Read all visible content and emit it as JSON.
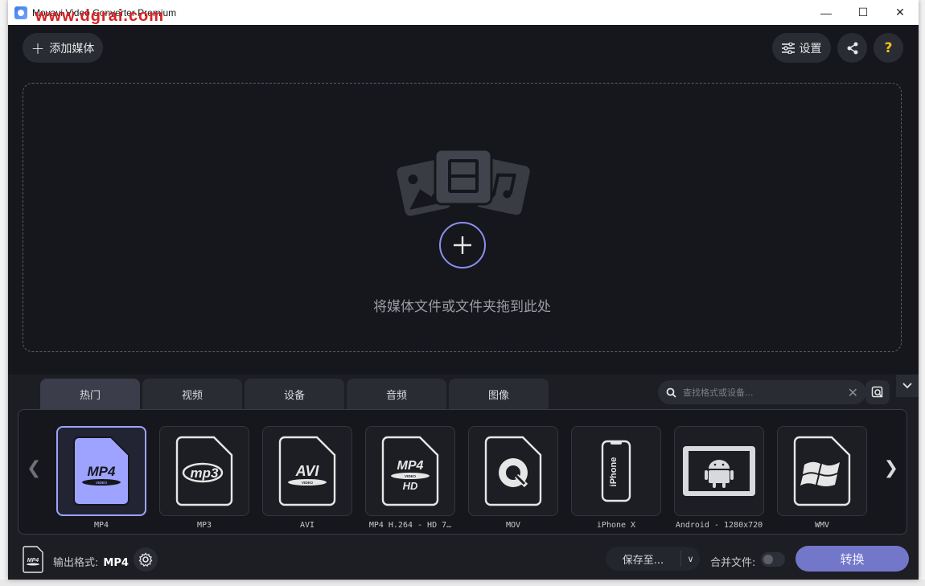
{
  "window": {
    "title": "Movavi Video Converter Premium",
    "watermark": "www.dgrai.com",
    "controls": {
      "minimize": "—",
      "maximize": "☐",
      "close": "✕"
    }
  },
  "toolbar": {
    "add_media_label": "添加媒体",
    "settings_label": "设置",
    "help_label": "?"
  },
  "dropzone": {
    "text": "将媒体文件或文件夹拖到此处"
  },
  "tabs": [
    {
      "label": "热门",
      "active": true
    },
    {
      "label": "视频",
      "active": false
    },
    {
      "label": "设备",
      "active": false
    },
    {
      "label": "音频",
      "active": false
    },
    {
      "label": "图像",
      "active": false
    }
  ],
  "search": {
    "placeholder": "查找格式或设备..."
  },
  "formats": [
    {
      "label": "MP4",
      "icon": "mp4-icon",
      "selected": true
    },
    {
      "label": "MP3",
      "icon": "mp3-icon"
    },
    {
      "label": "AVI",
      "icon": "avi-icon"
    },
    {
      "label": "MP4 H.264 - HD 7…",
      "icon": "mp4-hd-icon"
    },
    {
      "label": "MOV",
      "icon": "quicktime-icon"
    },
    {
      "label": "iPhone X",
      "icon": "iphone-icon"
    },
    {
      "label": "Android - 1280x720",
      "icon": "android-icon"
    },
    {
      "label": "WMV",
      "icon": "windows-icon"
    }
  ],
  "footer": {
    "output_format_label": "输出格式:",
    "output_format_value": "MP4",
    "save_to_label": "保存至...",
    "merge_label": "合并文件:",
    "merge_enabled": false,
    "convert_label": "转换"
  },
  "colors": {
    "accent": "#9da3ff",
    "convert": "#7277c9",
    "help": "#f6c21c",
    "watermark": "#d92323"
  }
}
